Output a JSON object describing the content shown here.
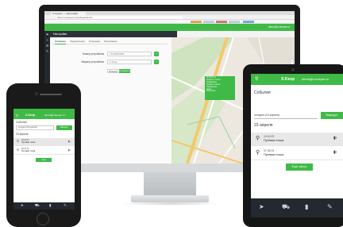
{
  "desktop": {
    "browser_tab": "X-Keeper — Настройки",
    "url": "https://x-keeper.ru/settings/device",
    "header_user": "demo@x-keeper.ru",
    "breadcrumb": "Настройки",
    "tabs": [
      "Основное",
      "Уведомления",
      "Операции",
      "Расписание"
    ],
    "form": {
      "label1": "Номер устройства",
      "value1": "71234567890",
      "label2": "Маркер устройства",
      "value2": "X-Keep",
      "cancel": "Отмена",
      "save": "Сохранить"
    },
    "info_popup": [
      "11:45:37 01",
      "Скорость: 0 км/ч",
      "Координаты",
      "Уровень: сигнал",
      "Напряжение",
      "Адрес",
      "Состояние"
    ]
  },
  "iphone": {
    "brand": "X-Keep",
    "email": "demo@x-keeper.ru",
    "title": "События",
    "select": "сегодня (23 апреля)",
    "route_button": "Маршрут",
    "date": "23 апреля",
    "events": [
      {
        "time": "09:42:29",
        "label": "Путевая точка"
      },
      {
        "time": "09:34:15",
        "label": "Путевая точка"
      }
    ],
    "more": "Ещё"
  },
  "ipad": {
    "brand": "X-Keep",
    "email": "demo@x-keeper.ru",
    "title": "События",
    "select": "сегодня (23 апреля)",
    "route_button": "Маршрут",
    "date": "23 апреля",
    "events": [
      {
        "time": "10:42:29",
        "label": "Путевая точка"
      },
      {
        "time": "07:38:15",
        "label": "Путевая точка"
      }
    ],
    "more": "Ещё запис"
  },
  "colors": {
    "accent": "#3fba46",
    "dark": "#23292e"
  },
  "icons": [
    "pin-icon",
    "menu-icon",
    "settings-icon",
    "tools-icon",
    "car-icon",
    "book-icon",
    "navigation-icon"
  ]
}
